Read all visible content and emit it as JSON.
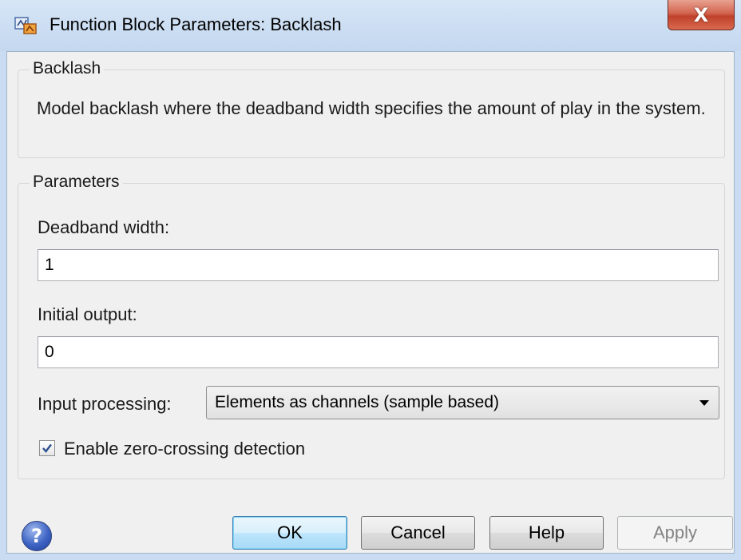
{
  "window": {
    "title": "Function Block Parameters: Backlash",
    "close_glyph": "X"
  },
  "description_group": {
    "label": "Backlash",
    "text": "Model backlash where the deadband width specifies the amount of play in the system."
  },
  "parameters_group": {
    "label": "Parameters",
    "deadband": {
      "label": "Deadband width:",
      "value": "1"
    },
    "initial_output": {
      "label": "Initial output:",
      "value": "0"
    },
    "input_processing": {
      "label": "Input processing:",
      "selected": "Elements as channels (sample based)"
    },
    "zero_crossing": {
      "label": "Enable zero-crossing detection",
      "checked": true
    }
  },
  "buttons": {
    "help_icon_glyph": "?",
    "ok": "OK",
    "cancel": "Cancel",
    "help": "Help",
    "apply": "Apply"
  },
  "icons": {
    "app": "simulink-block-icon",
    "close": "close-icon",
    "help": "help-icon",
    "dropdown": "chevron-down-icon",
    "check": "check-icon"
  },
  "colors": {
    "frame": "#c9dcf2",
    "client": "#f0f0f0",
    "close_button": "#c0412b",
    "default_button_border": "#3c7fb1",
    "help_icon": "#3d63c4"
  }
}
